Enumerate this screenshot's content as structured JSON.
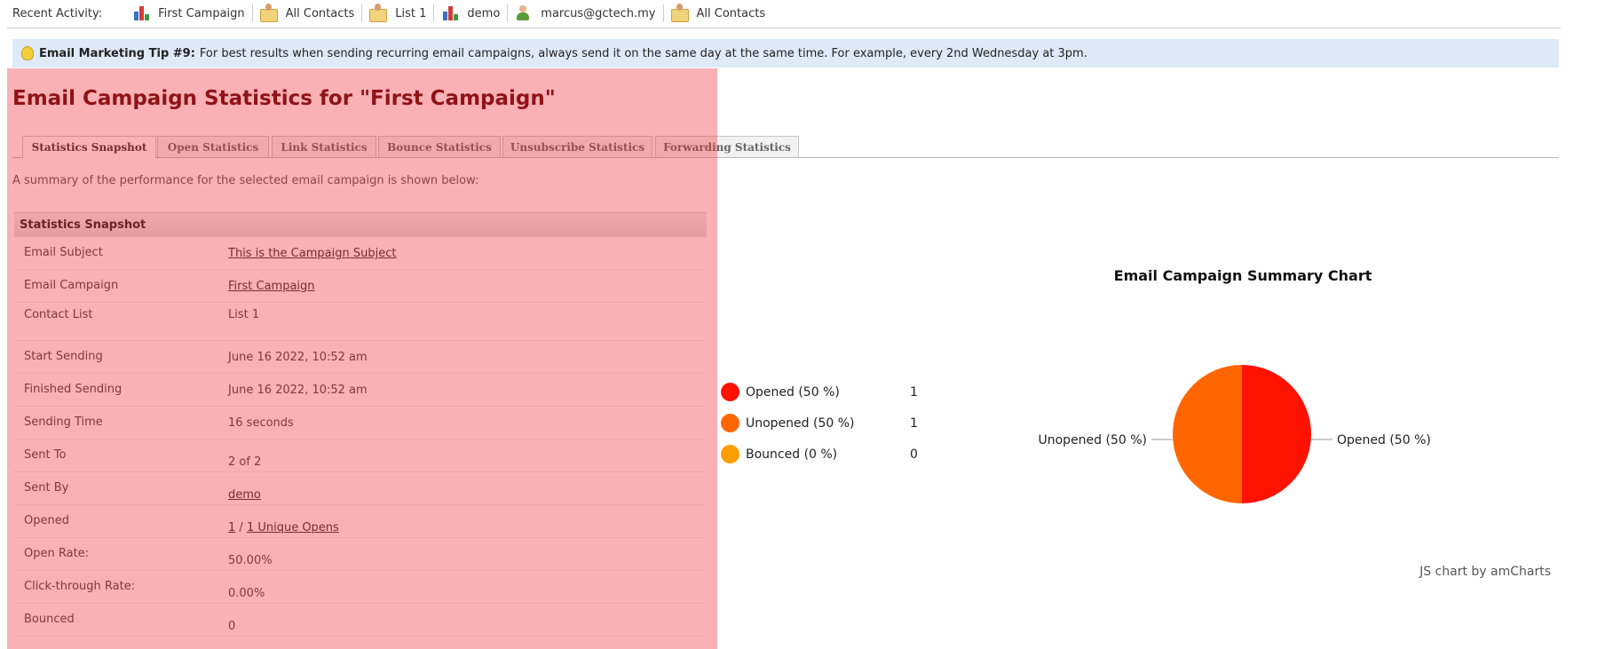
{
  "recent_activity": {
    "label": "Recent Activity:",
    "items": [
      {
        "label": "First Campaign",
        "icon": "chart-icon"
      },
      {
        "label": "All Contacts",
        "icon": "contact-list-icon"
      },
      {
        "label": "List 1",
        "icon": "contact-list-icon"
      },
      {
        "label": "demo",
        "icon": "chart-icon"
      },
      {
        "label": "marcus@gctech.my",
        "icon": "user-icon"
      },
      {
        "label": "All Contacts",
        "icon": "contact-list-icon"
      }
    ]
  },
  "tip": {
    "title": "Email Marketing Tip #9:",
    "text": "For best results when sending recurring email campaigns, always send it on the same day at the same time. For example, every 2nd Wednesday at 3pm."
  },
  "page_title": "Email Campaign Statistics for \"First Campaign\"",
  "tabs": [
    "Statistics Snapshot",
    "Open Statistics",
    "Link Statistics",
    "Bounce Statistics",
    "Unsubscribe Statistics",
    "Forwarding Statistics"
  ],
  "summary": "A summary of the performance for the selected email campaign is shown below:",
  "snapshot": {
    "heading": "Statistics Snapshot",
    "rows": [
      {
        "label": "Email Subject",
        "value": "This is the Campaign Subject"
      },
      {
        "label": "Email Campaign",
        "value": "First Campaign"
      },
      {
        "label": "Contact List",
        "value": "List 1"
      },
      {
        "label": "Start Sending",
        "value": "June 16 2022, 10:52 am"
      },
      {
        "label": "Finished Sending",
        "value": "June 16 2022, 10:52 am"
      },
      {
        "label": "Sending Time",
        "value": "16 seconds"
      },
      {
        "label": "Sent To",
        "value": "2 of 2"
      },
      {
        "label": "Sent By",
        "value": "demo"
      },
      {
        "label": "Opened",
        "value": "1",
        "value2": "1 Unique Opens",
        "sep": " / "
      },
      {
        "label": "Open Rate:",
        "value": "50.00%"
      },
      {
        "label": "Click-through Rate:",
        "value": "0.00%"
      },
      {
        "label": "Bounced",
        "value": "0"
      }
    ]
  },
  "chart_data": {
    "type": "pie",
    "title": "Email Campaign Summary Chart",
    "credit": "JS chart by amCharts",
    "legend_placement": "left",
    "slices": [
      {
        "name": "Opened",
        "value": 1,
        "percent": 50,
        "label": "Opened (50 %)",
        "color": "#ff1200"
      },
      {
        "name": "Unopened",
        "value": 1,
        "percent": 50,
        "label": "Unopened (50 %)",
        "color": "#ff6600"
      },
      {
        "name": "Bounced",
        "value": 0,
        "percent": 0,
        "label": "Bounced (0 %)",
        "color": "#ff9e01"
      }
    ]
  }
}
